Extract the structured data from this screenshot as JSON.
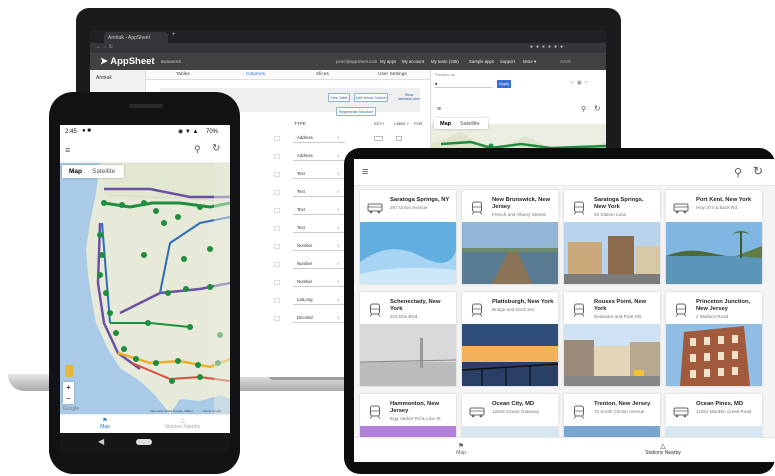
{
  "laptop": {
    "browser_tab": "Amtrak - AppSheet",
    "url": "appsheet.com/Template/AppDef?appName=Amtrak-306439&quickStart=False&sidebar=...",
    "app_header": {
      "logo": "AppSheet",
      "badge": "BUSINESS",
      "email": "peter@appsheet.com",
      "nav": [
        "My apps",
        "My account",
        "My team (185)",
        "Sample apps",
        "Support",
        "More ▾"
      ],
      "save": "SAVE"
    },
    "sidebar_app_name": "Amtrak",
    "tabs": [
      "Tables",
      "Columns",
      "Slices",
      "User Settings"
    ],
    "active_tab": "Columns",
    "buttons": {
      "view_table": "View Table",
      "add_virtual": "Add Virtual Column",
      "regenerate": "Regenerate Structure",
      "show_less": "Show standard view"
    },
    "column_headers": {
      "type": "TYPE",
      "key": "KEY?",
      "label": "LABEL?",
      "formula": "FOR"
    },
    "rows": [
      {
        "type": "Address",
        "key": false
      },
      {
        "type": "Address",
        "key": false
      },
      {
        "type": "Text",
        "key": false
      },
      {
        "type": "Text",
        "key": false
      },
      {
        "type": "Text",
        "key": false
      },
      {
        "type": "Text",
        "key": false
      },
      {
        "type": "Number",
        "key": false
      },
      {
        "type": "Number",
        "key": false
      },
      {
        "type": "Number",
        "key": false
      },
      {
        "type": "LatLong",
        "key": true
      },
      {
        "type": "Decimal",
        "key": false
      }
    ],
    "preview_label": "Preview as",
    "apply_button": "Apply",
    "map_tabs": [
      "Map",
      "Satellite"
    ]
  },
  "phone": {
    "status_time": "2:45",
    "status_right": "70%",
    "map_tabs": [
      "Map",
      "Satellite"
    ],
    "nav_items": [
      "Map",
      "Stations Nearby"
    ],
    "map_footer": "Map data ©2018 Google, INEGI",
    "map_terms": "Terms of Use",
    "google": "Google"
  },
  "tablet": {
    "nav_items": [
      "Map",
      "Stations Nearby"
    ],
    "stations": [
      {
        "name": "Saratoga Springs, NY",
        "address": "267 Union Avenue",
        "icon": "bus-icon",
        "scene": "sky"
      },
      {
        "name": "New Brunswick, New Jersey",
        "address": "French and Albany Streets",
        "icon": "train-icon",
        "scene": "pier"
      },
      {
        "name": "Saratoga Springs, New York",
        "address": "26 Station Lane",
        "icon": "train-icon",
        "scene": "street"
      },
      {
        "name": "Port Kent, New York",
        "address": "Hwy 373 & Back Rd.",
        "icon": "bus-icon",
        "scene": "lake"
      },
      {
        "name": "Schenectady, New York",
        "address": "332 Erie Blvd.",
        "icon": "train-icon",
        "scene": "fog"
      },
      {
        "name": "Plattsburgh, New York",
        "address": "Bridge and Dock Sts.",
        "icon": "train-icon",
        "scene": "sunset"
      },
      {
        "name": "Rouses Point, New York",
        "address": "Delaware and Pratt Sts.",
        "icon": "train-icon",
        "scene": "town"
      },
      {
        "name": "Princeton Junction, New Jersey",
        "address": "2 Wallace Road",
        "icon": "train-icon",
        "scene": "building"
      },
      {
        "name": "Hammonton, New Jersey",
        "address": "Egg Harbor Rd & Line St.",
        "icon": "train-icon",
        "scene": "purple"
      },
      {
        "name": "Ocean City, MD",
        "address": "12848 Ocean Gateway",
        "icon": "bus-icon",
        "scene": "sea"
      },
      {
        "name": "Trenton, New Jersey",
        "address": "72 South Clinton Avenue",
        "icon": "train-icon",
        "scene": "beach"
      },
      {
        "name": "Ocean Pines, MD",
        "address": "11051 Manklin Creek Road",
        "icon": "bus-icon",
        "scene": "sea"
      }
    ]
  },
  "colors": {
    "accent": "#1a73e8",
    "appsheet_header": "#414141",
    "green_marker": "#1e8e3e",
    "purple_route": "#6a51a3",
    "yellow_route": "#e9b22c"
  }
}
